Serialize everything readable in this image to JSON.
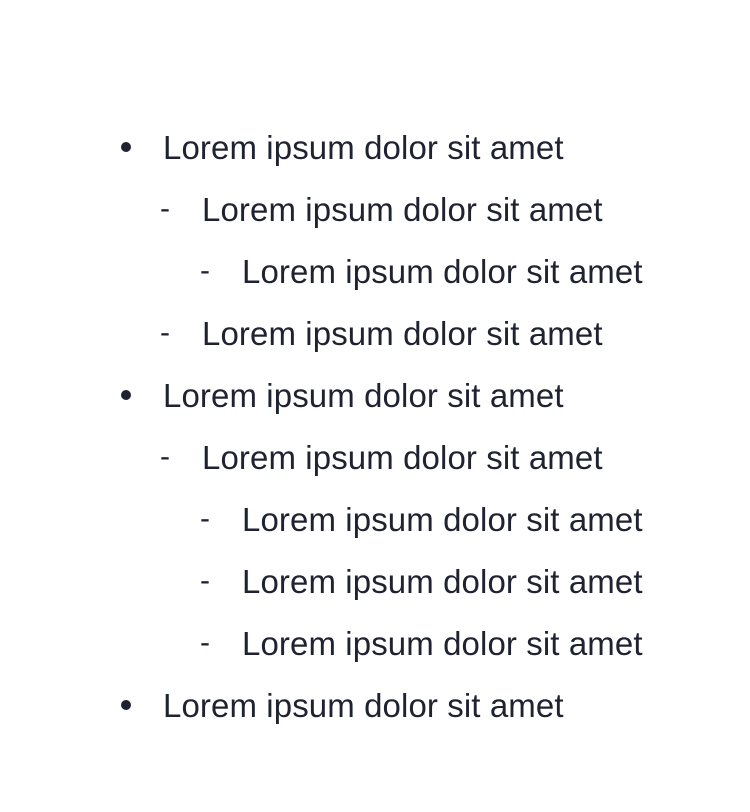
{
  "list": {
    "items": [
      {
        "level": 0,
        "marker": "•",
        "text": "Lorem ipsum dolor sit amet"
      },
      {
        "level": 1,
        "marker": "-",
        "text": "Lorem ipsum dolor sit amet"
      },
      {
        "level": 2,
        "marker": "-",
        "text": "Lorem ipsum dolor sit amet"
      },
      {
        "level": 1,
        "marker": "-",
        "text": "Lorem ipsum dolor sit amet"
      },
      {
        "level": 0,
        "marker": "•",
        "text": "Lorem ipsum dolor sit amet"
      },
      {
        "level": 1,
        "marker": "-",
        "text": "Lorem ipsum dolor sit amet"
      },
      {
        "level": 2,
        "marker": "-",
        "text": "Lorem ipsum dolor sit amet"
      },
      {
        "level": 2,
        "marker": "-",
        "text": "Lorem ipsum dolor sit amet"
      },
      {
        "level": 2,
        "marker": "-",
        "text": "Lorem ipsum dolor sit amet"
      },
      {
        "level": 0,
        "marker": "•",
        "text": "Lorem ipsum dolor sit amet"
      }
    ]
  }
}
